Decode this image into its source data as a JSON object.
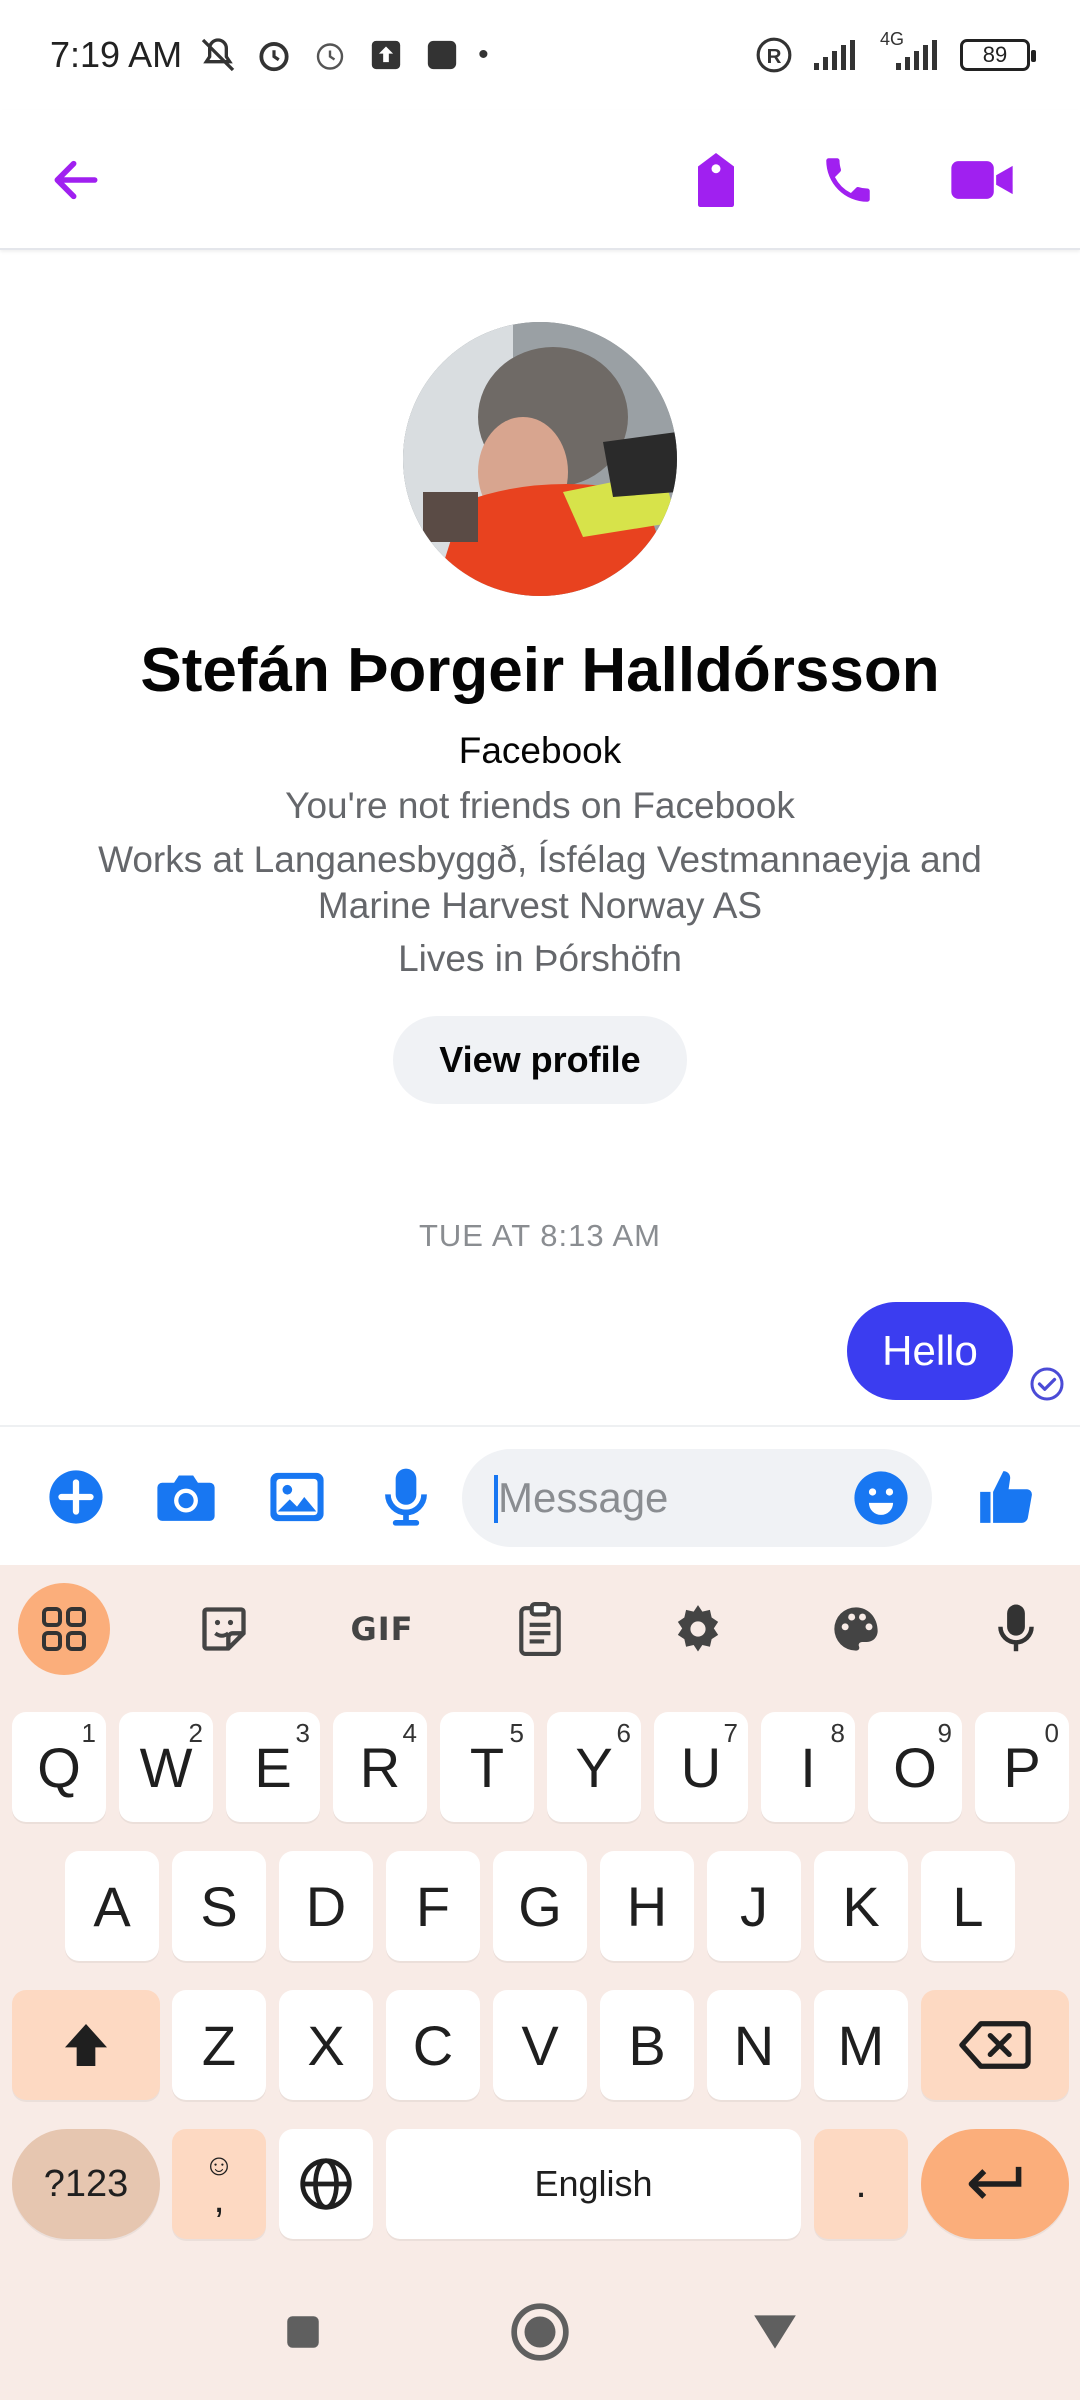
{
  "status_bar": {
    "time": "7:19 AM",
    "network": "4G",
    "battery": "89"
  },
  "header": {
    "back_icon": "arrow-left-icon",
    "actions": [
      "tag-icon",
      "phone-icon",
      "video-icon"
    ],
    "accent_color": "#a020f0"
  },
  "profile": {
    "name": "Stefán Þorgeir Halldórsson",
    "source": "Facebook",
    "friend_status": "You're not friends on Facebook",
    "work_line1": "Works at Langanesbyggð, Ísfélag Vestmannaeyja and",
    "work_line2": "Marine Harvest Norway AS",
    "lives": "Lives in Þórshöfn",
    "view_profile_label": "View profile"
  },
  "conversation": {
    "timestamp": "TUE AT 8:13 AM",
    "messages": [
      {
        "from": "me",
        "text": "Hello",
        "status": "sent"
      }
    ],
    "bubble_color": "#3b3df0"
  },
  "composer": {
    "placeholder": "Message",
    "icons": [
      "plus-icon",
      "camera-icon",
      "gallery-icon",
      "microphone-icon",
      "emoji-icon",
      "like-icon"
    ],
    "accent_color": "#1877f2"
  },
  "keyboard": {
    "toolbar": [
      "apps-icon",
      "sticker-icon",
      "gif-icon",
      "clipboard-icon",
      "settings-icon",
      "palette-icon",
      "microphone-icon"
    ],
    "gif_label": "GIF",
    "row1": [
      {
        "k": "Q",
        "h": "1"
      },
      {
        "k": "W",
        "h": "2"
      },
      {
        "k": "E",
        "h": "3"
      },
      {
        "k": "R",
        "h": "4"
      },
      {
        "k": "T",
        "h": "5"
      },
      {
        "k": "Y",
        "h": "6"
      },
      {
        "k": "U",
        "h": "7"
      },
      {
        "k": "I",
        "h": "8"
      },
      {
        "k": "O",
        "h": "9"
      },
      {
        "k": "P",
        "h": "0"
      }
    ],
    "row2": [
      "A",
      "S",
      "D",
      "F",
      "G",
      "H",
      "J",
      "K",
      "L"
    ],
    "row3": [
      "Z",
      "X",
      "C",
      "V",
      "B",
      "N",
      "M"
    ],
    "symbols_label": "?123",
    "comma_label": ",",
    "space_label": "English",
    "period_label": "."
  },
  "navbar": {
    "buttons": [
      "recents-icon",
      "home-icon",
      "back-icon"
    ]
  }
}
